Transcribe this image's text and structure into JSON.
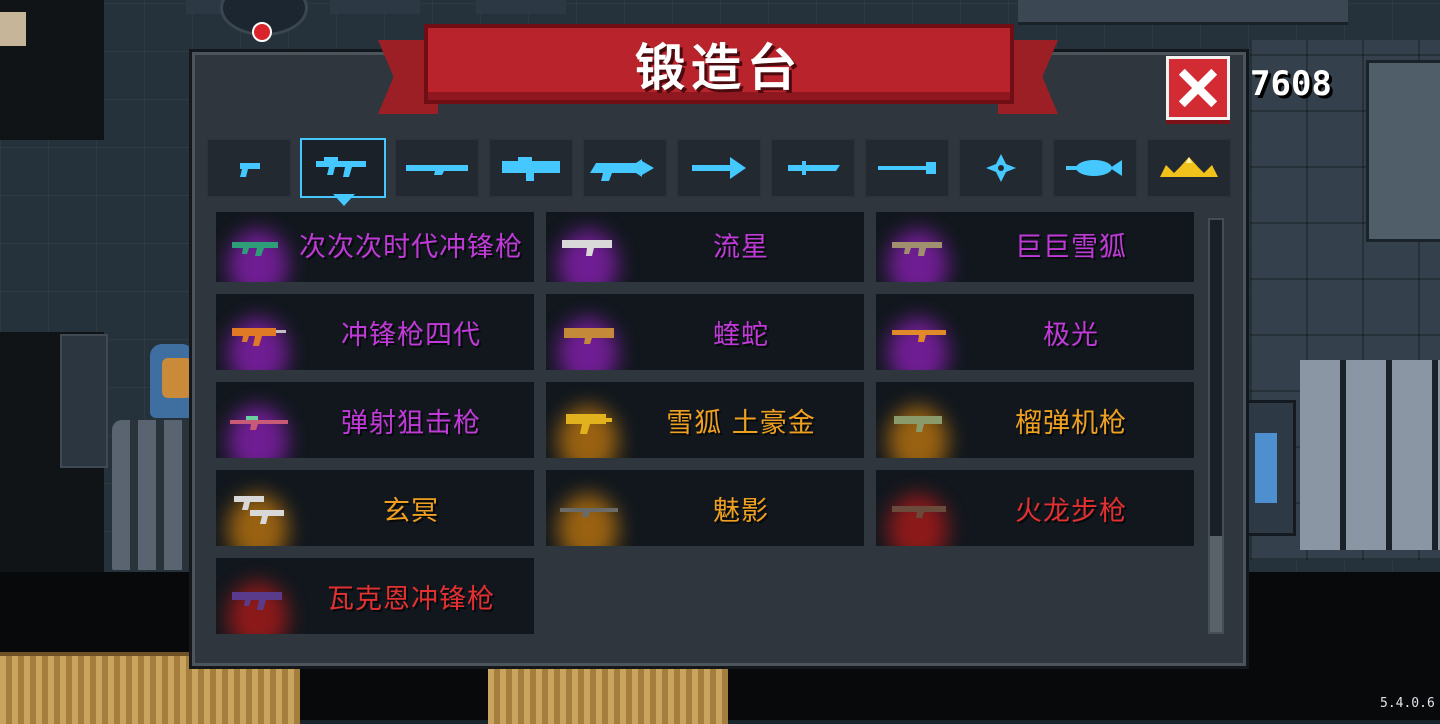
{
  "window": {
    "title": "锻造台"
  },
  "currency": {
    "amount": "7608"
  },
  "version": "5.4.0.6",
  "tabs": [
    {
      "name": "pistol",
      "active": false
    },
    {
      "name": "smg",
      "active": true
    },
    {
      "name": "rifle",
      "active": false
    },
    {
      "name": "launcher",
      "active": false
    },
    {
      "name": "heavy-gun",
      "active": false
    },
    {
      "name": "arrow",
      "active": false
    },
    {
      "name": "blade",
      "active": false
    },
    {
      "name": "staff",
      "active": false
    },
    {
      "name": "shuriken",
      "active": false
    },
    {
      "name": "fish",
      "active": false
    },
    {
      "name": "crown",
      "active": false
    }
  ],
  "weapons": [
    {
      "name": "次次次时代冲锋枪",
      "text_color": "#c03ad8",
      "glow_color": "#7a1ea0",
      "icon_color": "#2e9e78"
    },
    {
      "name": "流星",
      "text_color": "#c03ad8",
      "glow_color": "#7a1ea0",
      "icon_color": "#d9d9d9"
    },
    {
      "name": "巨巨雪狐",
      "text_color": "#c03ad8",
      "glow_color": "#7a1ea0",
      "icon_color": "#a09070"
    },
    {
      "name": "冲锋枪四代",
      "text_color": "#c03ad8",
      "glow_color": "#7a1ea0",
      "icon_color": "#e07a24"
    },
    {
      "name": "蝰蛇",
      "text_color": "#c03ad8",
      "glow_color": "#7a1ea0",
      "icon_color": "#c48a3a"
    },
    {
      "name": "极光",
      "text_color": "#c03ad8",
      "glow_color": "#7a1ea0",
      "icon_color": "#e08a2a"
    },
    {
      "name": "弹射狙击枪",
      "text_color": "#c03ad8",
      "glow_color": "#7a1ea0",
      "icon_color": "#c85a78"
    },
    {
      "name": "雪狐 土豪金",
      "text_color": "#f0a020",
      "glow_color": "#a86a10",
      "icon_color": "#e2b21e"
    },
    {
      "name": "榴弹机枪",
      "text_color": "#f0a020",
      "glow_color": "#a86a10",
      "icon_color": "#8a9a6a"
    },
    {
      "name": "玄冥",
      "text_color": "#f0a020",
      "glow_color": "#a86a10",
      "icon_color": "#d8d8d8"
    },
    {
      "name": "魅影",
      "text_color": "#f0a020",
      "glow_color": "#a86a10",
      "icon_color": "#6a6a6a"
    },
    {
      "name": "火龙步枪",
      "text_color": "#e43030",
      "glow_color": "#9a1a1a",
      "icon_color": "#6a4a3a"
    },
    {
      "name": "瓦克恩冲锋枪",
      "text_color": "#e43030",
      "glow_color": "#9a1a1a",
      "icon_color": "#5a3a8a"
    }
  ]
}
